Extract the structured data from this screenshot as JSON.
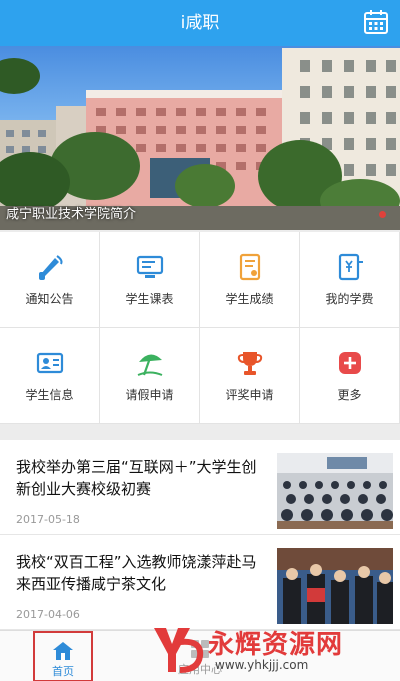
{
  "header": {
    "title": "i咸职",
    "calendar_icon": "calendar-icon"
  },
  "banner": {
    "caption": "咸宁职业技术学院简介"
  },
  "grid": [
    {
      "label": "通知公告",
      "icon": "megaphone-icon",
      "color": "#2e8bd8"
    },
    {
      "label": "学生课表",
      "icon": "monitor-icon",
      "color": "#2e8bd8"
    },
    {
      "label": "学生成绩",
      "icon": "grade-document-icon",
      "color": "#f0a23a"
    },
    {
      "label": "我的学费",
      "icon": "tuition-document-icon",
      "color": "#2e8bd8"
    },
    {
      "label": "学生信息",
      "icon": "id-card-icon",
      "color": "#2e8bd8"
    },
    {
      "label": "请假申请",
      "icon": "beach-umbrella-icon",
      "color": "#3bb15f"
    },
    {
      "label": "评奖申请",
      "icon": "trophy-icon",
      "color": "#e8552a"
    },
    {
      "label": "更多",
      "icon": "more-plus-icon",
      "color": "#e84a4a"
    }
  ],
  "news": [
    {
      "title": "我校举办第三届“互联网＋”大学生创新创业大赛校级初赛",
      "date": "2017-05-18"
    },
    {
      "title": "我校“双百工程”入选教师饶漾萍赴马来西亚传播咸宁茶文化",
      "date": "2017-04-06"
    }
  ],
  "tabbar": {
    "home_label": "首页",
    "second_label": "应用中心"
  },
  "watermark": {
    "title": "永辉资源网",
    "url": "www.yhkjjj.com"
  }
}
